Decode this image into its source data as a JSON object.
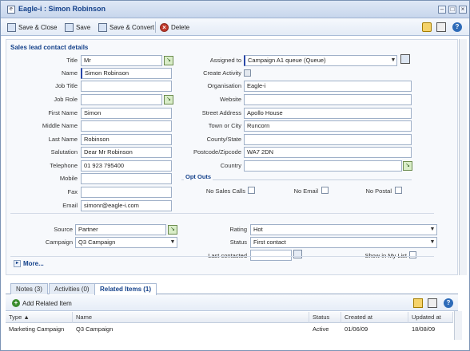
{
  "window": {
    "title": "Eagle-i : Simon Robinson"
  },
  "toolbar": {
    "save_close": "Save & Close",
    "save": "Save",
    "save_convert": "Save & Convert",
    "delete": "Delete"
  },
  "form": {
    "section_title": "Sales lead contact details",
    "left": {
      "title_label": "Title",
      "title_value": "Mr",
      "name_label": "Name",
      "name_value": "Simon Robinson",
      "job_title_label": "Job Title",
      "job_title_value": "",
      "job_role_label": "Job Role",
      "job_role_value": "",
      "first_name_label": "First Name",
      "first_name_value": "Simon",
      "middle_name_label": "Middle Name",
      "middle_name_value": "",
      "last_name_label": "Last Name",
      "last_name_value": "Robinson",
      "salutation_label": "Salutation",
      "salutation_value": "Dear Mr Robinson",
      "telephone_label": "Telephone",
      "telephone_value": "01 923 795400",
      "mobile_label": "Mobile",
      "mobile_value": "",
      "fax_label": "Fax",
      "fax_value": "",
      "email_label": "Email",
      "email_value": "simonr@eagle-i.com"
    },
    "right": {
      "assigned_label": "Assigned to",
      "assigned_value": "Campaign A1 queue (Queue)",
      "create_activity_label": "Create Activity",
      "organisation_label": "Organisation",
      "organisation_value": "Eagle-i",
      "website_label": "Website",
      "website_value": "",
      "street_label": "Street Address",
      "street_value": "Apollo House",
      "town_label": "Town or City",
      "town_value": "Runcorn",
      "county_label": "County/State",
      "county_value": "",
      "postcode_label": "Postcode/Zipcode",
      "postcode_value": "WA7 2DN",
      "country_label": "Country",
      "country_value": ""
    },
    "opt_outs": {
      "title": "Opt Outs",
      "no_sales_calls": "No Sales Calls",
      "no_email": "No Email",
      "no_postal": "No Postal"
    },
    "bottom": {
      "source_label": "Source",
      "source_value": "Partner",
      "campaign_label": "Campaign",
      "campaign_value": "Q3 Campaign",
      "rating_label": "Rating",
      "rating_value": "Hot",
      "status_label": "Status",
      "status_value": "First contact",
      "last_contacted_label": "Last contacted",
      "last_contacted_value": "",
      "show_in_list_label": "Show in My List"
    },
    "more_label": "More..."
  },
  "tabs": [
    {
      "label": "Notes (3)"
    },
    {
      "label": "Activities (0)"
    },
    {
      "label": "Related Items (1)"
    }
  ],
  "related": {
    "add_label": "Add Related Item",
    "columns": [
      "Type",
      "Name",
      "Status",
      "Created at",
      "Updated at"
    ],
    "rows": [
      {
        "type": "Marketing Campaign",
        "name": "Q3 Campaign",
        "status": "Active",
        "created": "01/06/09",
        "updated": "18/08/09"
      }
    ]
  }
}
